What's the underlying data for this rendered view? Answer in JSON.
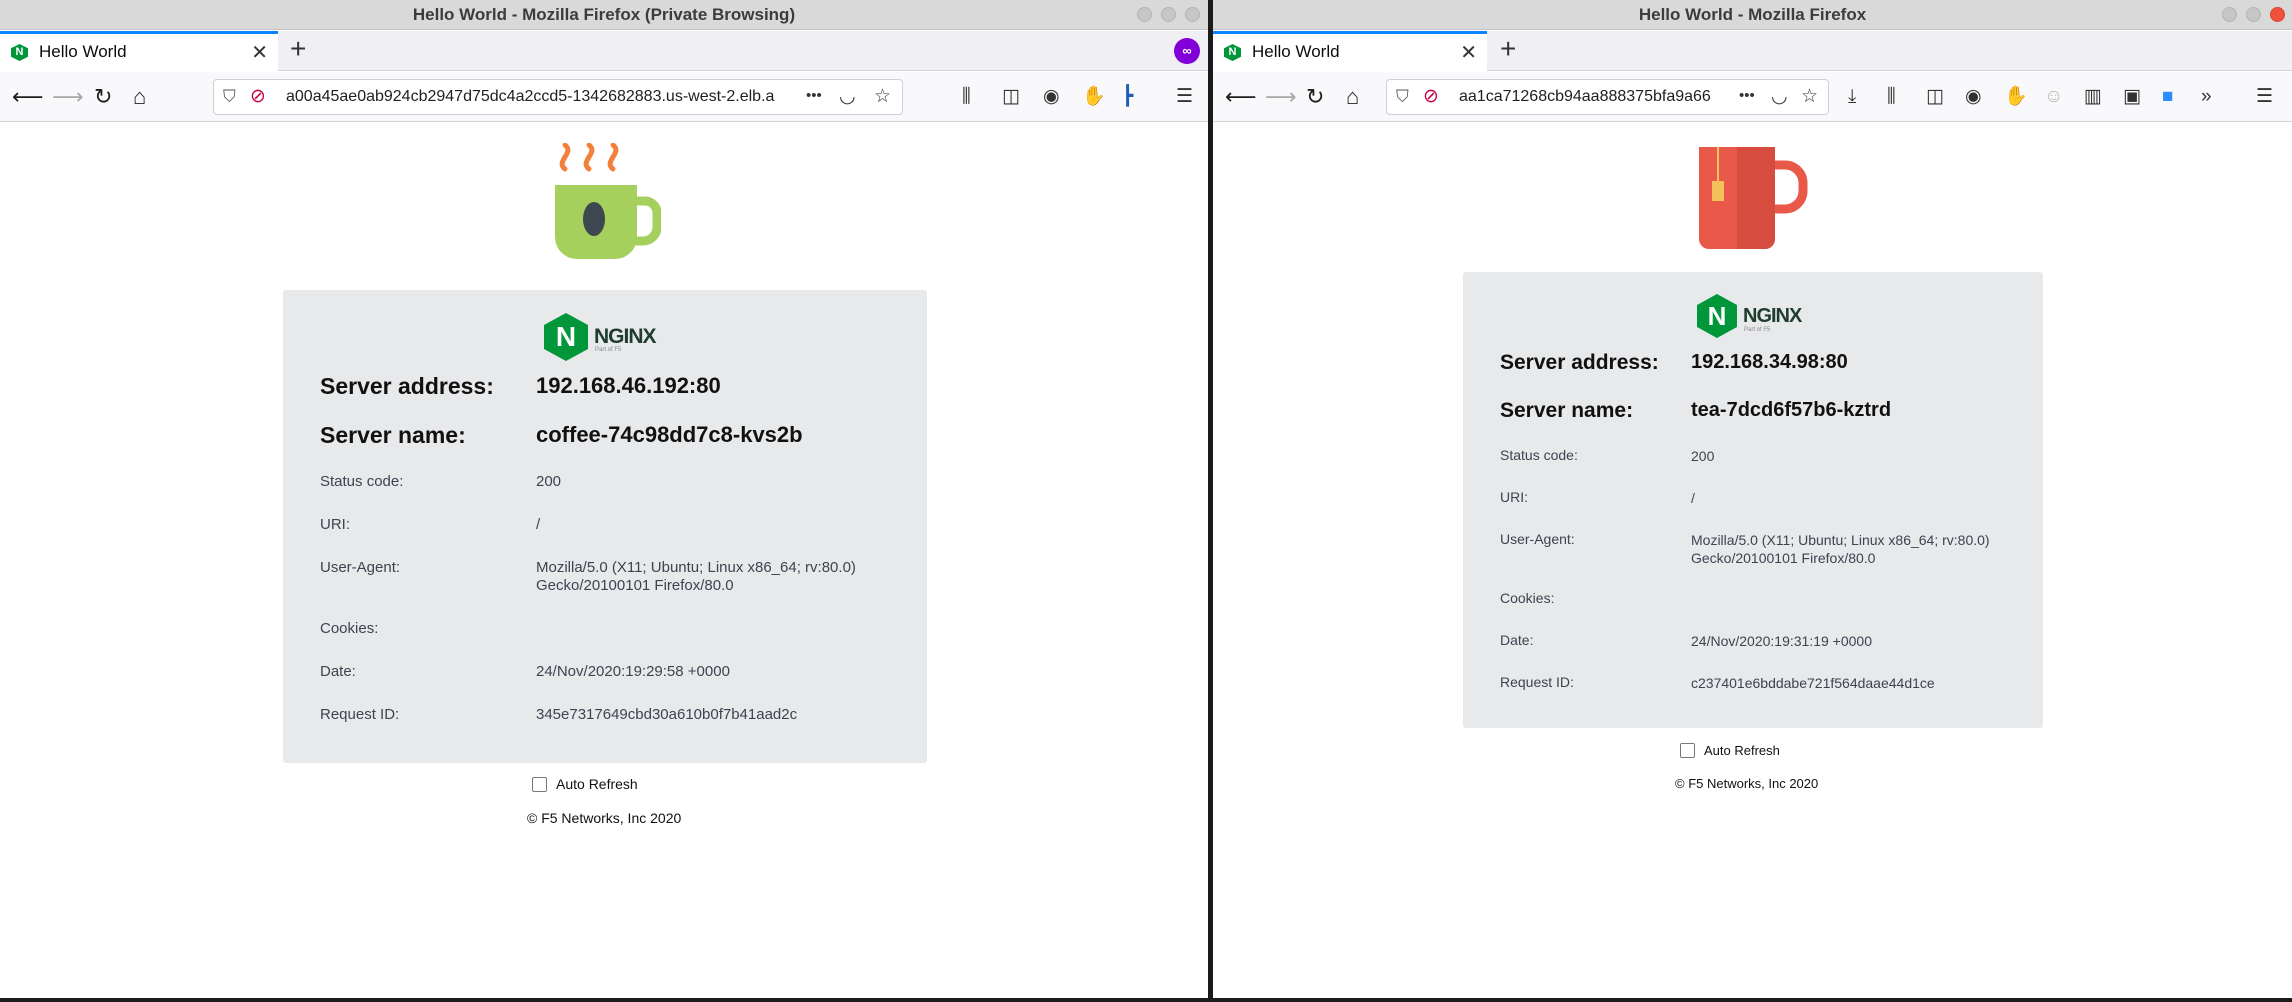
{
  "left": {
    "window_title": "Hello World - Mozilla Firefox (Private Browsing)",
    "tab_title": "Hello World",
    "url": "a00a45ae0ab924cb2947d75dc4a2ccd5-1342682883.us-west-2.elb.a",
    "server_address_label": "Server address:",
    "server_address": "192.168.46.192:80",
    "server_name_label": "Server name:",
    "server_name": "coffee-74c98dd7c8-kvs2b",
    "status_code_label": "Status code:",
    "status_code": "200",
    "uri_label": "URI:",
    "uri": "/",
    "user_agent_label": "User-Agent:",
    "user_agent_line1": "Mozilla/5.0 (X11; Ubuntu; Linux x86_64; rv:80.0)",
    "user_agent_line2": "Gecko/20100101 Firefox/80.0",
    "cookies_label": "Cookies:",
    "date_label": "Date:",
    "date": "24/Nov/2020:19:29:58 +0000",
    "request_id_label": "Request ID:",
    "request_id": "345e7317649cbd30a610b0f7b41aad2c",
    "auto_refresh": "Auto Refresh",
    "copyright": "© F5 Networks, Inc 2020"
  },
  "right": {
    "window_title": "Hello World - Mozilla Firefox",
    "tab_title": "Hello World",
    "url": "aa1ca71268cb94aa888375bfa9a66",
    "server_address_label": "Server address:",
    "server_address": "192.168.34.98:80",
    "server_name_label": "Server name:",
    "server_name": "tea-7dcd6f57b6-kztrd",
    "status_code_label": "Status code:",
    "status_code": "200",
    "uri_label": "URI:",
    "uri": "/",
    "user_agent_label": "User-Agent:",
    "user_agent_line1": "Mozilla/5.0 (X11; Ubuntu; Linux x86_64; rv:80.0)",
    "user_agent_line2": "Gecko/20100101 Firefox/80.0",
    "cookies_label": "Cookies:",
    "date_label": "Date:",
    "date": "24/Nov/2020:19:31:19 +0000",
    "request_id_label": "Request ID:",
    "request_id": "c237401e6bddabe721f564daae44d1ce",
    "auto_refresh": "Auto Refresh",
    "copyright": "© F5 Networks, Inc 2020"
  },
  "common": {
    "nginx_logo_text": "NGINX",
    "nginx_logo_sub": "Part of F5",
    "tab_close_glyph": "✕",
    "new_tab_glyph": "+",
    "overflow_glyph": "•••"
  },
  "icons": {
    "coffee": "coffee-cup-icon",
    "tea": "tea-mug-icon",
    "private": "private-browsing-mask-icon"
  },
  "colors": {
    "nginx_green": "#009639",
    "tab_accent": "#0a84ff",
    "private_purple": "#8000d7",
    "coffee_cup": "#a5d05e",
    "coffee_steam": "#f2803a",
    "tea_mug": "#e8594a",
    "panel_bg": "#e8e9eb"
  }
}
